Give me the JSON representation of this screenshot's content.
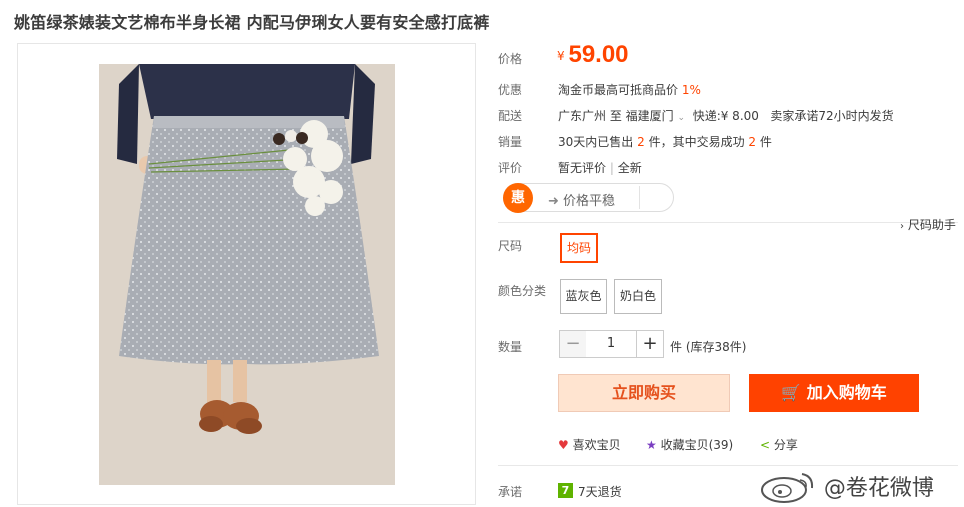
{
  "title": "姚笛绿茶婊装文艺棉布半身长裙  内配马伊琍女人要有安全感打底裤",
  "price": {
    "label": "价格",
    "currency": "¥",
    "value": "59.00"
  },
  "promo": {
    "label": "优惠",
    "text": "淘金币最高可抵商品价",
    "percent": "1%"
  },
  "shipping": {
    "label": "配送",
    "from": "广东广州 至",
    "to": "福建厦门",
    "express": "快递:¥ 8.00",
    "promise": "卖家承诺72小时内发货"
  },
  "sales": {
    "label": "销量",
    "p1": "30天内已售出",
    "n1": "2",
    "p2": "件，其中交易成功",
    "n2": "2",
    "p3": "件"
  },
  "review": {
    "label": "评价",
    "none": "暂无评价",
    "sep": "|",
    "new": "全新"
  },
  "hui": {
    "icon": "惠",
    "text": "价格平稳",
    "arrow": "➜"
  },
  "size_help": "尺码助手",
  "size": {
    "label": "尺码",
    "options": [
      "均码"
    ]
  },
  "color": {
    "label": "颜色分类",
    "options": [
      "蓝灰色",
      "奶白色"
    ]
  },
  "qty": {
    "label": "数量",
    "minus": "−",
    "value": "1",
    "plus": "+",
    "stock": "件 (库存38件)"
  },
  "buttons": {
    "buy": "立即购买",
    "cart": "加入购物车"
  },
  "social": {
    "fav": "喜欢宝贝",
    "collect": "收藏宝贝(39)",
    "share": "分享"
  },
  "promise": {
    "label": "承诺",
    "badge": "7",
    "text": "7天退货"
  },
  "watermark": "@卷花微博",
  "colors": {
    "accent": "#ff4400",
    "buy_bg": "#ffe4d0",
    "cart_bg": "#ff4200",
    "badge_green": "#5fb300"
  }
}
